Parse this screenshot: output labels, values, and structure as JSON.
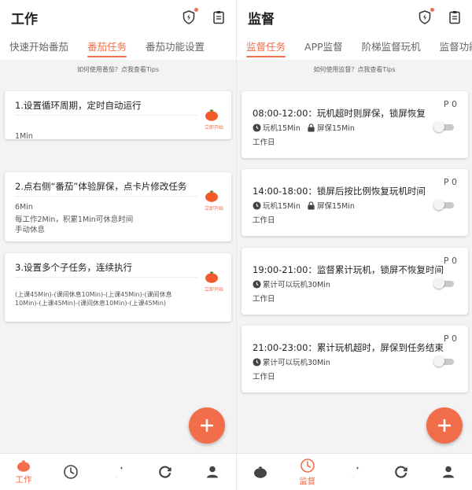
{
  "colors": {
    "accent": "#f36e4c",
    "fab": "#f26d49",
    "background": "#f3f3f3"
  },
  "left": {
    "title": "工作",
    "tabs": [
      {
        "label": "快速开始番茄",
        "active": false
      },
      {
        "label": "番茄任务",
        "active": true
      },
      {
        "label": "番茄功能设置",
        "active": false
      }
    ],
    "tips": "如何使用番茄？点我查看Tips",
    "start_label": "立即开始",
    "cards": [
      {
        "title": "1.设置循环周期，定时自动运行",
        "lines": [
          "1Min"
        ]
      },
      {
        "title": "2.点右侧“番茄”体验屏保，点卡片修改任务",
        "lines": [
          "6Min",
          "每工作2Min，积累1Min可休息时间",
          "手动休息"
        ]
      },
      {
        "title": "3.设置多个子任务，连续执行",
        "lines": [
          "(上课45Min)-(课间休息10Min)-(上课45Min)-(课间休息",
          "10Min)-(上课45Min)-(课间休息10Min)-(上课45Min)"
        ]
      }
    ],
    "nav_label": "工作",
    "nav_icons": [
      "tomato-icon",
      "clock-icon",
      "moon-icon",
      "refresh-icon",
      "person-icon"
    ]
  },
  "right": {
    "title": "监督",
    "tabs": [
      {
        "label": "监督任务",
        "active": true
      },
      {
        "label": "APP监督",
        "active": false
      },
      {
        "label": "阶梯监督玩机",
        "active": false
      },
      {
        "label": "监督功能设",
        "active": false
      }
    ],
    "tips": "如何使用监督？点我查看Tips",
    "tasks": [
      {
        "title": "08:00-12:00：玩机超时则屏保，锁屏恢复",
        "badge": "P 0",
        "play": "玩机15Min",
        "lock": "屏保15Min",
        "day": "工作日",
        "enabled": false
      },
      {
        "title": "14:00-18:00：锁屏后按比例恢复玩机时间",
        "badge": "P 0",
        "play": "玩机15Min",
        "lock": "屏保15Min",
        "day": "工作日",
        "enabled": false
      },
      {
        "title": "19:00-21:00：监督累计玩机，锁屏不恢复时间",
        "badge": "P 0",
        "play": "累计可以玩机30Min",
        "lock": "",
        "day": "工作日",
        "enabled": false
      },
      {
        "title": "21:00-23:00：累计玩机超时，屏保到任务结束",
        "badge": "P 0",
        "play": "累计可以玩机30Min",
        "lock": "",
        "day": "工作日",
        "enabled": false
      }
    ],
    "nav_label": "监督",
    "nav_icons": [
      "tomato-icon",
      "clock-icon",
      "moon-icon",
      "refresh-icon",
      "person-icon"
    ]
  }
}
